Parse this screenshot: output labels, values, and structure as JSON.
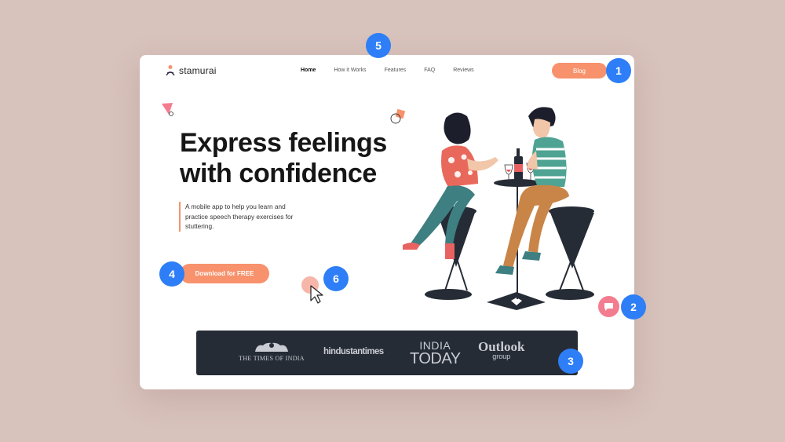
{
  "brand": {
    "name": "stamurai"
  },
  "nav": {
    "items": [
      {
        "label": "Home",
        "active": true
      },
      {
        "label": "How it Works"
      },
      {
        "label": "Features"
      },
      {
        "label": "FAQ"
      },
      {
        "label": "Reviews"
      }
    ],
    "blog_label": "Blog"
  },
  "hero": {
    "headline_line1": "Express feelings",
    "headline_line2": "with confidence",
    "description": "A mobile app to help you learn and practice speech therapy exercises for stuttering.",
    "cta_label": "Download for FREE"
  },
  "press": {
    "logos": [
      {
        "name": "THE TIMES OF INDIA"
      },
      {
        "name": "hindustantimes"
      },
      {
        "line1": "INDIA",
        "line2": "TODAY"
      },
      {
        "line1": "Outlook",
        "line2": "group"
      }
    ]
  },
  "annotations": [
    "1",
    "2",
    "3",
    "4",
    "5",
    "6"
  ],
  "colors": {
    "accent": "#f7926d",
    "badge": "#2d7ef7",
    "press_bg": "#262c36",
    "page_bg": "#d8c2bc",
    "chat": "#f37d8f"
  },
  "icons": [
    "stamurai-logo-icon",
    "chat-icon",
    "mouse-cursor-icon",
    "triangle-decoration-icon"
  ]
}
